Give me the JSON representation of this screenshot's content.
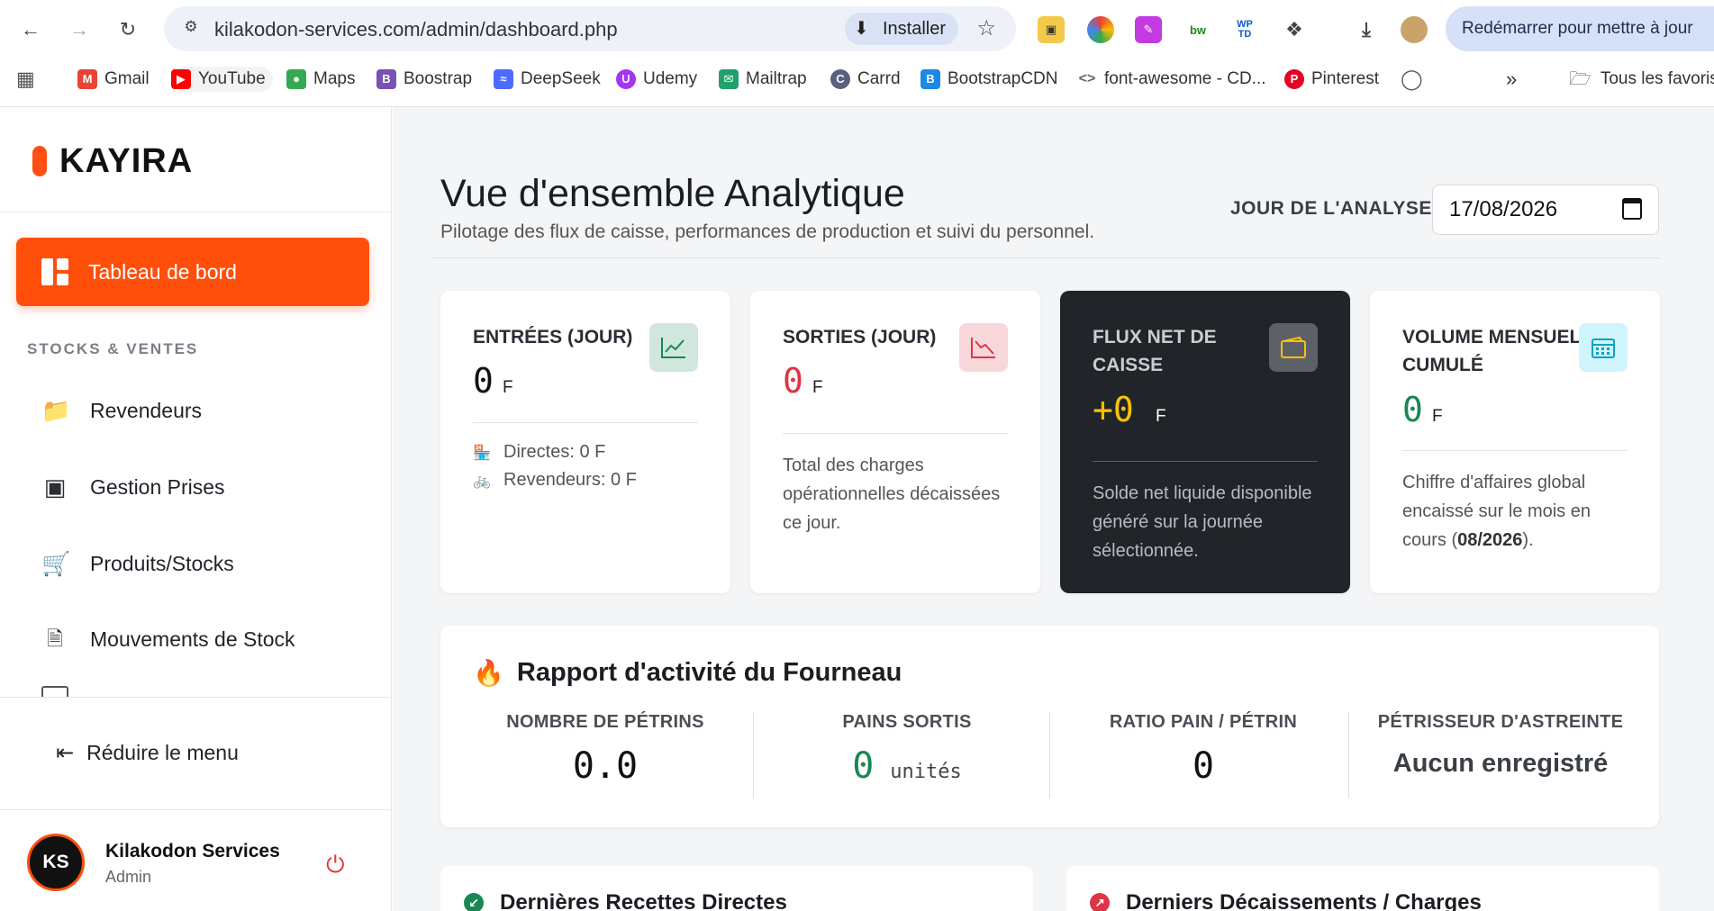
{
  "browser": {
    "url": "kilakodon-services.com/admin/dashboard.php",
    "install_label": "Installer",
    "update_label": "Redémarrer pour mettre à jour",
    "bookmarks": [
      {
        "label": "Gmail",
        "icon": "gmail-icon",
        "color": "#ea4335"
      },
      {
        "label": "YouTube",
        "icon": "youtube-icon",
        "color": "#ff0000"
      },
      {
        "label": "Maps",
        "icon": "maps-icon",
        "color": "#34a853"
      },
      {
        "label": "Boostrap",
        "icon": "bootstrap-icon",
        "color": "#7952b3"
      },
      {
        "label": "DeepSeek",
        "icon": "deepseek-icon",
        "color": "#4d6bfe"
      },
      {
        "label": "Udemy",
        "icon": "udemy-icon",
        "color": "#a435f0"
      },
      {
        "label": "Mailtrap",
        "icon": "mailtrap-icon",
        "color": "#22a06b"
      },
      {
        "label": "Carrd",
        "icon": "carrd-icon",
        "color": "#596080"
      },
      {
        "label": "BootstrapCDN",
        "icon": "bootstrapcdn-icon",
        "color": "#1e88e5"
      },
      {
        "label": "font-awesome - CD...",
        "icon": "code-icon",
        "color": "#666666"
      },
      {
        "label": "Pinterest",
        "icon": "pinterest-icon",
        "color": "#e60023"
      }
    ],
    "all_bookmarks_label": "Tous les favoris"
  },
  "sidebar": {
    "brand": "KAYIRA",
    "active_item": "Tableau de bord",
    "section_label": "STOCKS & VENTES",
    "items": [
      {
        "label": "Revendeurs",
        "icon": "folder-icon"
      },
      {
        "label": "Gestion Prises",
        "icon": "box-icon"
      },
      {
        "label": "Produits/Stocks",
        "icon": "cart-icon"
      },
      {
        "label": "Mouvements de Stock",
        "icon": "file-plus-icon"
      }
    ],
    "collapse_label": "Réduire le menu",
    "user": {
      "initials": "KS",
      "name": "Kilakodon Services",
      "role": "Admin"
    }
  },
  "header": {
    "title": "Vue d'ensemble Analytique",
    "subtitle": "Pilotage des flux de caisse, performances de production et suivi du personnel.",
    "date_label": "JOUR DE L'ANALYSE :",
    "date_value": "17/08/2026"
  },
  "cards": {
    "entries": {
      "title": "ENTRÉES (JOUR)",
      "value": "0",
      "unit": "F",
      "direct": "Directes: 0 F",
      "resellers": "Revendeurs: 0 F",
      "color": "#198754"
    },
    "exits": {
      "title": "SORTIES (JOUR)",
      "value": "0",
      "unit": "F",
      "desc": "Total des charges opérationnelles décaissées ce jour.",
      "color": "#dc3545"
    },
    "net": {
      "title": "FLUX NET DE CAISSE",
      "value": "+0",
      "unit": "F",
      "desc": "Solde net liquide disponible généré sur la journée sélectionnée.",
      "color": "#ffc107"
    },
    "monthly": {
      "title": "VOLUME MENSUEL CUMULÉ",
      "value": "0",
      "unit": "F",
      "desc_prefix": "Chiffre d'affaires global encaissé sur le mois en cours (",
      "desc_month": "08/2026",
      "desc_suffix": ").",
      "color": "#198754"
    }
  },
  "oven": {
    "title": "Rapport d'activité du Fourneau",
    "stats": [
      {
        "label": "NOMBRE DE PÉTRINS",
        "value": "0.0"
      },
      {
        "label": "PAINS SORTIS",
        "value": "0",
        "unit": "unités"
      },
      {
        "label": "RATIO PAIN / PÉTRIN",
        "value": "0"
      },
      {
        "label": "PÉTRISSEUR D'ASTREINTE",
        "value": "Aucun enregistré"
      }
    ]
  },
  "bottom": {
    "recipes_title": "Dernières Recettes Directes",
    "charges_title": "Derniers Décaissements / Charges"
  }
}
